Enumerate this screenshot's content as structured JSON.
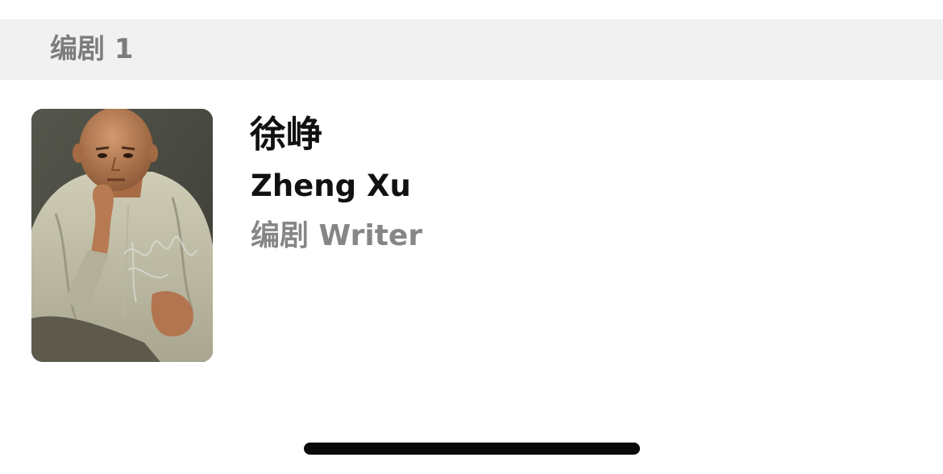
{
  "section": {
    "title": "编剧 1"
  },
  "person": {
    "name_cn": "徐峥",
    "name_en": "Zheng Xu",
    "role": "编剧 Writer",
    "photo_icon": "person-photo"
  },
  "colors": {
    "header_bg": "#f1f1f1",
    "title_gray": "#7c7c7c",
    "role_gray": "#868686",
    "text_dark": "#111111",
    "home_indicator": "#0a0a0a"
  }
}
